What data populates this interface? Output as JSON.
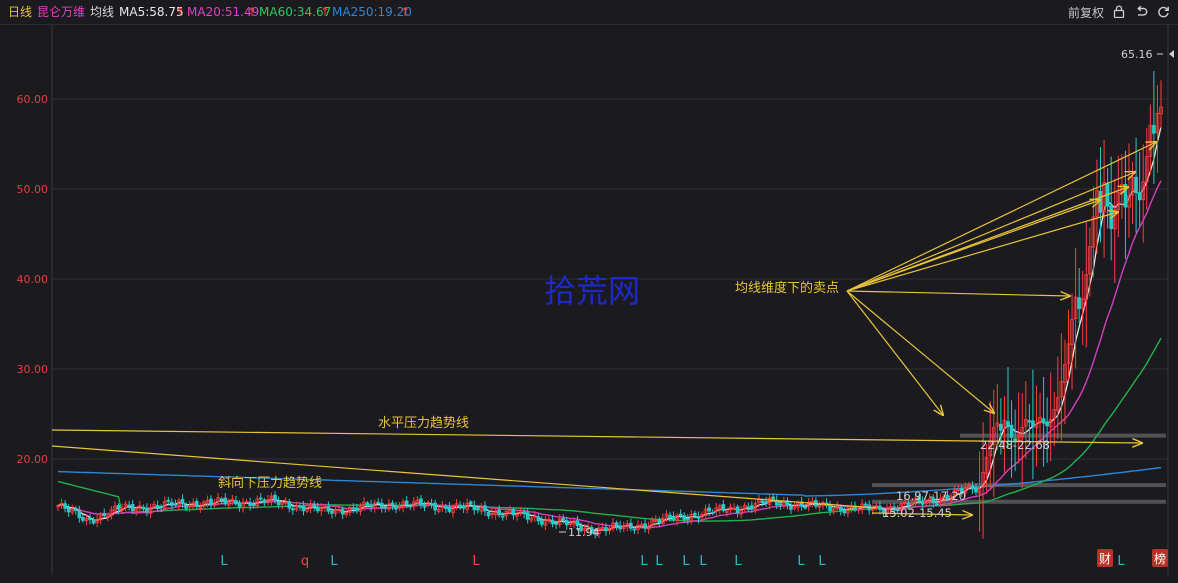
{
  "header": {
    "period": "日线",
    "stock_name": "昆仑万维",
    "ma_title": "均线",
    "ma5": "MA5:58.75",
    "ma20": "MA20:51.49",
    "ma60": "MA60:34.67",
    "ma250": "MA250:19.20",
    "adjust": "前复权",
    "colors": {
      "period": "#e8c33a",
      "stock": "#d8d8d8",
      "ma5": "#e8e8e8",
      "ma20": "#e040c8",
      "ma60": "#2ec95a",
      "ma250": "#2f86d4",
      "up_arrow": "#ff4040"
    },
    "icons": [
      "lock-icon",
      "undo-icon",
      "restart-icon"
    ]
  },
  "chart_data": {
    "type": "candlestick",
    "ylim": [
      10,
      67
    ],
    "yticks": [
      "20.00",
      "30.00",
      "40.00",
      "50.00",
      "60.00"
    ],
    "high_label": "65.16",
    "low_label": "11.94",
    "watermark": "拾荒网",
    "annotations": {
      "sell_points": "均线维度下的卖点",
      "horizontal_line": "水平压力趋势线",
      "diagonal_line": "斜向下压力趋势线",
      "zone1": "22.48-22.68",
      "zone2": "16.97-17.20",
      "zone3": "15.02-15.45"
    },
    "ma_series": [
      {
        "name": "MA5",
        "color": "#e8e8e8"
      },
      {
        "name": "MA20",
        "color": "#d43fc0"
      },
      {
        "name": "MA60",
        "color": "#22b04c"
      },
      {
        "name": "MA250",
        "color": "#2f86d4"
      }
    ],
    "bottom_markers": [
      {
        "text": "L",
        "color": "#2fb8c8"
      },
      {
        "text": "q",
        "color": "#ff4040"
      },
      {
        "text": "L",
        "color": "#2fb8c8"
      },
      {
        "text": "L",
        "color": "#ff4040"
      },
      {
        "text": "L",
        "color": "#2fb8c8"
      },
      {
        "text": "L",
        "color": "#2fb8c8"
      },
      {
        "text": "L",
        "color": "#2fb8c8"
      },
      {
        "text": "L",
        "color": "#2fb8c8"
      },
      {
        "text": "L",
        "color": "#2fb8c8"
      },
      {
        "text": "L",
        "color": "#2fb8c8"
      },
      {
        "text": "L",
        "color": "#2fb8c8"
      },
      {
        "text": "L",
        "color": "#2fb8c8"
      }
    ],
    "corner_badges": [
      "财",
      "榜"
    ],
    "colors": {
      "up": "#ff3b3b",
      "down": "#28c8c8",
      "grid": "#2e2e33",
      "axis_text": "#e04040",
      "annotation": "#e8c33a",
      "annotation_text": "#e8c33a",
      "label_text": "#cfcfcf",
      "watermark": "#1f2ad4",
      "support": "#808080"
    }
  }
}
